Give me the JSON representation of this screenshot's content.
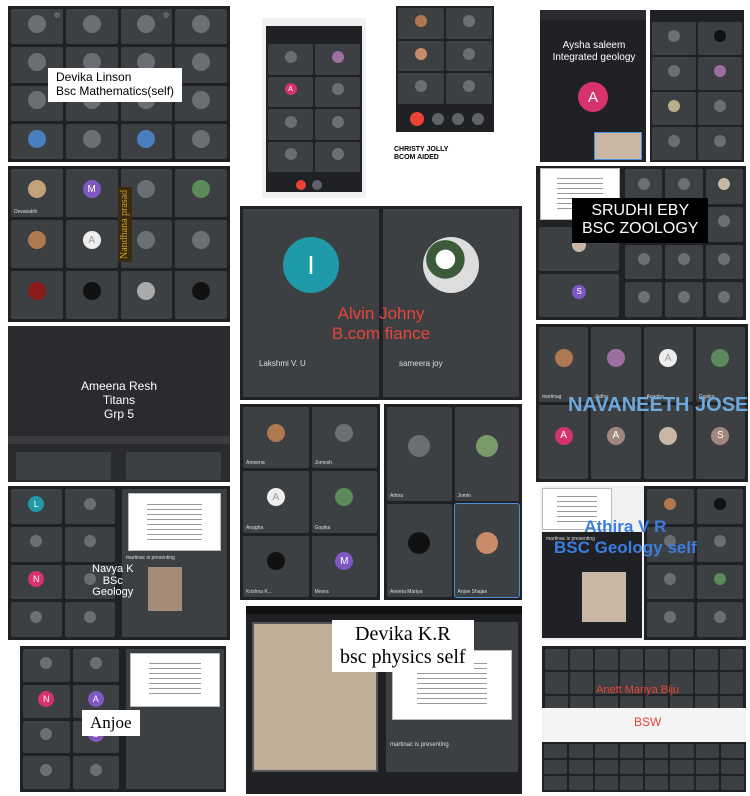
{
  "labels": {
    "devika_linson_name": "Devika Linson",
    "devika_linson_course": "Bsc Mathematics(self)",
    "christy_name": "CHRISTY JOLLY",
    "christy_course": "BCOM AIDED",
    "aysha_name": "Aysha saleem",
    "aysha_course": "Integrated geology",
    "srudhi_name": "SRUDHI EBY",
    "srudhi_course": "BSC ZOOLOGY",
    "vertical_name": "Nandhana prasad",
    "alvin_name": "Alvin Johny",
    "alvin_course": "B.com fiance",
    "ameena_name": "Ameena Resh",
    "ameena_team": "Titans",
    "ameena_group": "Grp 5",
    "navaneeth": "NAVANEETH JOSE",
    "navya_name": "Navya K",
    "navya_deg": "BSc",
    "navya_course": "Geology",
    "athira_name": "Athira V R",
    "athira_course": "BSC Geology self",
    "devika_kr_name": "Devika K.R",
    "devika_kr_course": "bsc physics self",
    "anjoe": "Anjoe",
    "anett": "Anett Mariya Biju",
    "bsw": "BSW"
  },
  "participants": {
    "lakshmi": "Lakshmi V. U",
    "sameera": "sameera joy",
    "ameena": "Ameena",
    "jomesh": "Jomesh",
    "anagha": "Anagha",
    "gopika": "Gopika",
    "krishna": "Krishna K...",
    "meera": "Meera",
    "athira": "Athira",
    "jomin": "Jomin",
    "aneeta": "Aneeta Mariya",
    "anjoe_shajan": "Anjoe Shajan",
    "presenting": "martinac is presenting"
  },
  "avatars": {
    "i": "I",
    "a": "A",
    "m": "M",
    "s": "S",
    "l": "L",
    "n": "N"
  },
  "colors": {
    "meet_bg": "#202124",
    "tile_bg": "#3c4043",
    "red_label": "#e8443a",
    "blue_label": "#3b7de0",
    "teal_avatar": "#1e9aa8",
    "pink_avatar": "#d6336c"
  }
}
